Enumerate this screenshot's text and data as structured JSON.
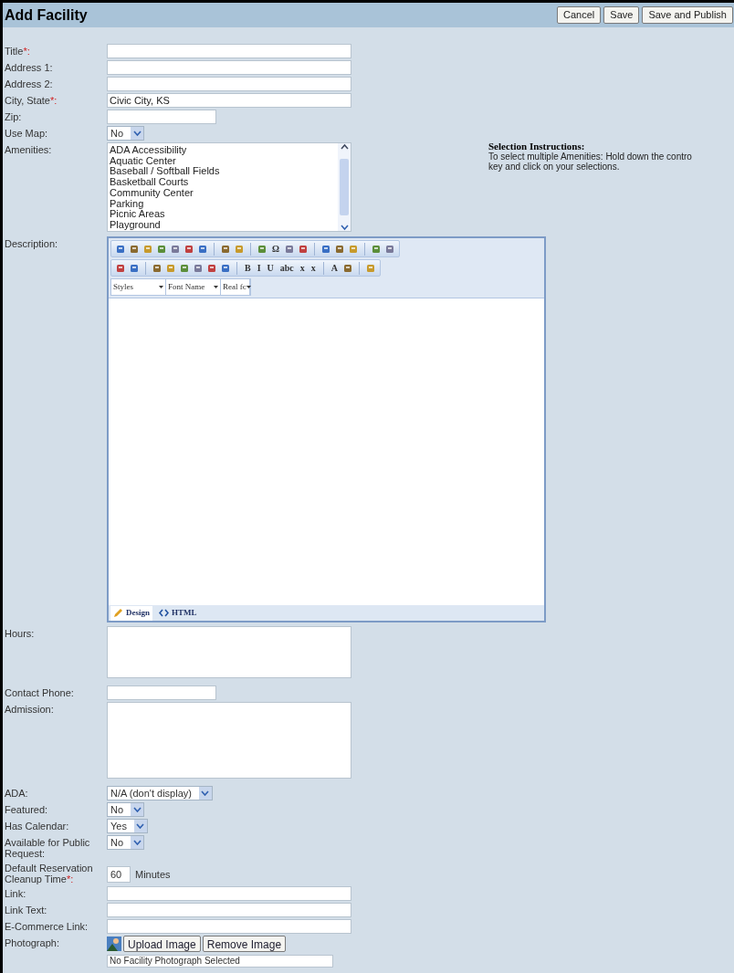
{
  "window": {
    "title": "Add Facility"
  },
  "header_buttons": [
    "Cancel",
    "Save",
    "Save and Publish"
  ],
  "fields": [
    {
      "kind": "text",
      "label": "Title",
      "required_mark": "*:"
    },
    {
      "kind": "text",
      "label": "Address 1:"
    },
    {
      "kind": "text",
      "label": "Address 2:"
    },
    {
      "kind": "text",
      "label": "City, State",
      "required_mark": "*:",
      "value": "Civic City, KS"
    },
    {
      "kind": "short_text",
      "label": "Zip:"
    },
    {
      "kind": "select",
      "label": "Use Map:",
      "value": "No"
    },
    {
      "kind": "listbox",
      "label": "Amenities:",
      "options": [
        "ADA Accessibility",
        "Aquatic Center",
        "Baseball / Softball Fields",
        "Basketball Courts",
        "Community Center",
        "Parking",
        "Picnic Areas",
        "Playground"
      ],
      "help": {
        "title": "Selection Instructions:",
        "lines": [
          "To select multiple Amenities: Hold down the contro",
          "key and click on your selections."
        ]
      }
    },
    {
      "kind": "editor",
      "label": "Description:",
      "toolbar_rows": [
        [
          {
            "kind": "icon"
          },
          {
            "kind": "icon"
          },
          {
            "kind": "icon"
          },
          {
            "kind": "icon"
          },
          {
            "kind": "icon"
          },
          {
            "kind": "icon"
          },
          {
            "kind": "icon"
          },
          {
            "kind": "sep"
          },
          {
            "kind": "icon"
          },
          {
            "kind": "icon"
          },
          {
            "kind": "sep"
          },
          {
            "kind": "icon"
          },
          {
            "kind": "glyph",
            "text": "Ω"
          },
          {
            "kind": "icon"
          },
          {
            "kind": "icon"
          },
          {
            "kind": "sep"
          },
          {
            "kind": "icon"
          },
          {
            "kind": "icon"
          },
          {
            "kind": "icon"
          },
          {
            "kind": "sep"
          },
          {
            "kind": "icon"
          },
          {
            "kind": "icon"
          }
        ],
        [
          {
            "kind": "icon"
          },
          {
            "kind": "icon"
          },
          {
            "kind": "sep"
          },
          {
            "kind": "icon"
          },
          {
            "kind": "icon"
          },
          {
            "kind": "icon"
          },
          {
            "kind": "icon"
          },
          {
            "kind": "icon"
          },
          {
            "kind": "icon"
          },
          {
            "kind": "sep"
          },
          {
            "kind": "glyph",
            "text": "B"
          },
          {
            "kind": "glyph",
            "text": "I"
          },
          {
            "kind": "glyph",
            "text": "U"
          },
          {
            "kind": "glyph",
            "text": "abc"
          },
          {
            "kind": "glyph",
            "text": "x"
          },
          {
            "kind": "glyph",
            "text": "x"
          },
          {
            "kind": "sep"
          },
          {
            "kind": "glyph",
            "text": "A"
          },
          {
            "kind": "icon"
          },
          {
            "kind": "sep"
          },
          {
            "kind": "icon"
          }
        ]
      ],
      "dropdowns": [
        "Styles",
        "Font Name",
        "Real fc"
      ],
      "tabs": [
        {
          "label": "Design",
          "selected": true
        },
        {
          "label": "HTML",
          "selected": false
        }
      ]
    },
    {
      "kind": "textarea",
      "label": "Hours:"
    },
    {
      "kind": "short_text",
      "label": "Contact Phone:"
    },
    {
      "kind": "textarea",
      "label": "Admission:"
    },
    {
      "kind": "select",
      "label": "ADA:",
      "value": "N/A (don't display)"
    },
    {
      "kind": "select",
      "label": "Featured:",
      "value": "No"
    },
    {
      "kind": "select",
      "label": "Has Calendar:",
      "value": "Yes"
    },
    {
      "kind": "select",
      "label": "Available for Public Request:",
      "value": "No"
    },
    {
      "kind": "number_unit",
      "label": "Default Reservation Cleanup Time",
      "required_mark": "*:",
      "value": "60",
      "unit": "Minutes"
    },
    {
      "kind": "text",
      "label": "Link:"
    },
    {
      "kind": "text",
      "label": "Link Text:"
    },
    {
      "kind": "text",
      "label": "E-Commerce Link:"
    },
    {
      "kind": "photo",
      "label": "Photograph:",
      "buttons": [
        "Upload Image",
        "Remove Image"
      ],
      "status": "No Facility Photograph Selected"
    }
  ]
}
